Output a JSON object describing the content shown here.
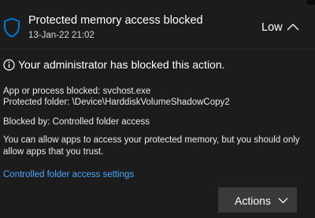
{
  "notification": {
    "title": "Protected memory access blocked",
    "timestamp": "13-Jan-22 21:02",
    "severity": "Low",
    "icon": "shield-icon",
    "collapse_icon": "chevron-up-icon"
  },
  "message": {
    "info_icon": "info-icon",
    "summary": "Your administrator has blocked this action."
  },
  "details": {
    "app_line": "App or process blocked: svchost.exe",
    "folder_line": "Protected folder:  \\Device\\HarddiskVolumeShadowCopy2",
    "blocked_by_line": "Blocked by:  Controlled folder access",
    "description_line1": "You can allow apps to access your protected memory, but you should only",
    "description_line2": "allow apps that you trust."
  },
  "link": {
    "label": "Controlled folder access settings"
  },
  "actions": {
    "label": "Actions",
    "icon": "chevron-down-icon"
  },
  "colors": {
    "background": "#1c1c1c",
    "link": "#4aa8ff",
    "accent": "#0078d4",
    "button": "#3a3a3a"
  }
}
